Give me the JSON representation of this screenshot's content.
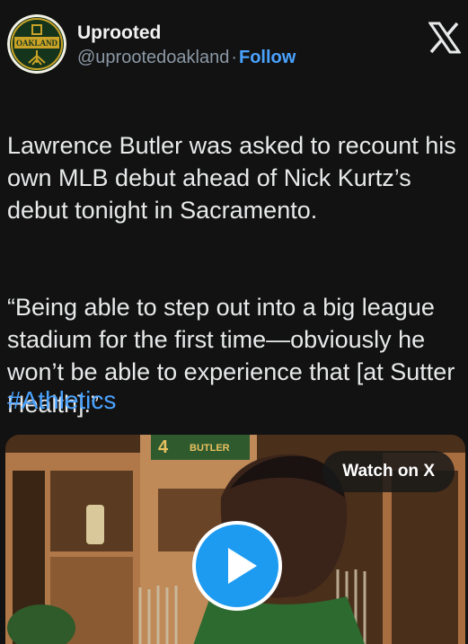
{
  "author": {
    "name": "Uprooted",
    "handle": "@uprootedoakland",
    "separator": "·",
    "follow_label": "Follow",
    "avatar_text": "OAKLAND"
  },
  "tweet": {
    "paragraph_1": "Lawrence Butler was asked to recount his own MLB debut ahead of Nick Kurtz’s debut tonight in Sacramento.",
    "paragraph_2": "“Being able to step out into a big league stadium for the first time—obviously he won’t be able to experience that [at Sutter Health].”",
    "hashtag": "#Athletics"
  },
  "media": {
    "watch_label": "Watch on X",
    "jersey_text": "4",
    "nameplate_text": "BUTLER"
  },
  "icons": {
    "brand": "x-logo-icon",
    "play": "play-icon"
  },
  "colors": {
    "link": "#4aa3ff",
    "play_button": "#1d9bf0",
    "background": "#121212"
  }
}
